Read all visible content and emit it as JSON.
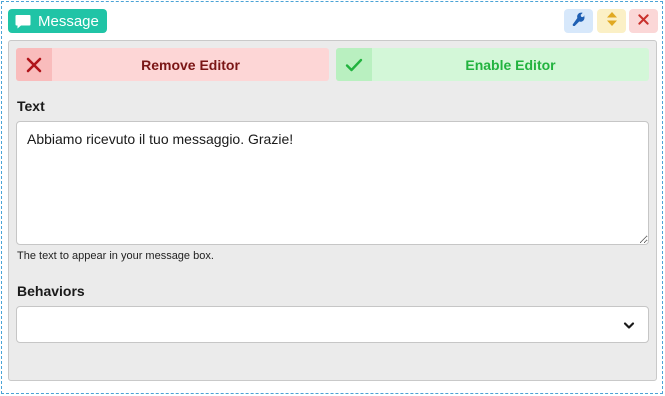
{
  "header": {
    "badge_label": "Message",
    "badge_icon": "chat-bubble-icon",
    "toolbar": [
      {
        "icon": "wrench-icon",
        "color": "#1e5fb3"
      },
      {
        "icon": "move-updown-icon",
        "color": "#e0a922"
      },
      {
        "icon": "close-icon",
        "color": "#c9302c"
      }
    ]
  },
  "editor_actions": {
    "remove_label": "Remove Editor",
    "enable_label": "Enable Editor"
  },
  "text_field": {
    "label": "Text",
    "value": "Abbiamo ricevuto il tuo messaggio. Grazie!",
    "help": "The text to appear in your message box."
  },
  "behaviors": {
    "label": "Behaviors",
    "selected": ""
  },
  "colors": {
    "accent": "#20c4a6",
    "remove_text": "#7a1616",
    "enable_text": "#22b33f"
  }
}
